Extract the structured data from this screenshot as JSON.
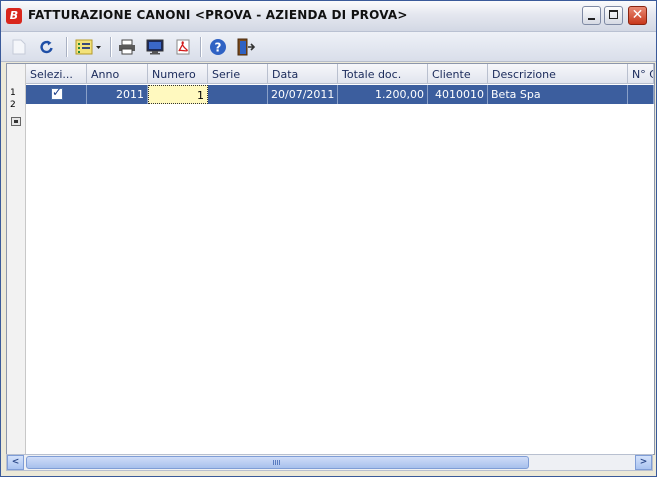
{
  "window": {
    "title": "FATTURAZIONE CANONI <PROVA - AZIENDA DI PROVA>",
    "app_icon_letter": "B"
  },
  "toolbar": {
    "buttons": [
      "new-doc-icon",
      "refresh-icon",
      "list-options-icon",
      "print-icon",
      "preview-screen-icon",
      "export-pdf-icon",
      "help-icon",
      "exit-icon"
    ]
  },
  "grid": {
    "columns": [
      "Selezi...",
      "Anno",
      "Numero",
      "Serie",
      "Data",
      "Totale doc.",
      "Cliente",
      "Descrizione",
      "N° C"
    ],
    "row_numbers": [
      "1",
      "2"
    ],
    "rows": [
      {
        "selected": true,
        "anno": "2011",
        "numero": "1",
        "serie": "",
        "data": "20/07/2011",
        "totale": "1.200,00",
        "cliente": "4010010",
        "descrizione": "Beta Spa",
        "nc": ""
      }
    ]
  },
  "scrollbar": {
    "left_arrow": "<",
    "right_arrow": ">"
  },
  "colors": {
    "selection": "#3c5e9e",
    "edit_cell": "#fff9bf",
    "close_button": "#c8381c"
  }
}
